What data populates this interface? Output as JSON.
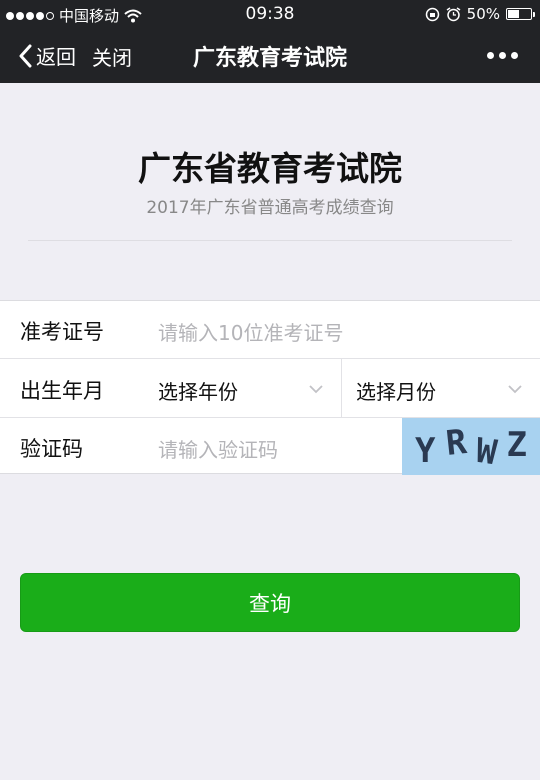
{
  "status_bar": {
    "carrier": "中国移动",
    "time": "09:38",
    "battery_text": "50%",
    "battery_level": 0.5,
    "signal_bars": 4
  },
  "navbar": {
    "back_label": "返回",
    "close_label": "关闭",
    "title": "广东教育考试院"
  },
  "header": {
    "title": "广东省教育考试院",
    "subtitle": "2017年广东省普通高考成绩查询"
  },
  "form": {
    "exam_id": {
      "label": "准考证号",
      "placeholder": "请输入10位准考证号"
    },
    "birth": {
      "label": "出生年月",
      "year_select": "选择年份",
      "month_select": "选择月份"
    },
    "captcha": {
      "label": "验证码",
      "placeholder": "请输入验证码",
      "code": [
        "Y",
        "R",
        "W",
        "Z"
      ]
    }
  },
  "submit_label": "查询",
  "colors": {
    "navbar_bg": "#222326",
    "page_bg": "#efeef4",
    "button_green": "#1aad19",
    "captcha_bg": "#a8d2f0"
  }
}
